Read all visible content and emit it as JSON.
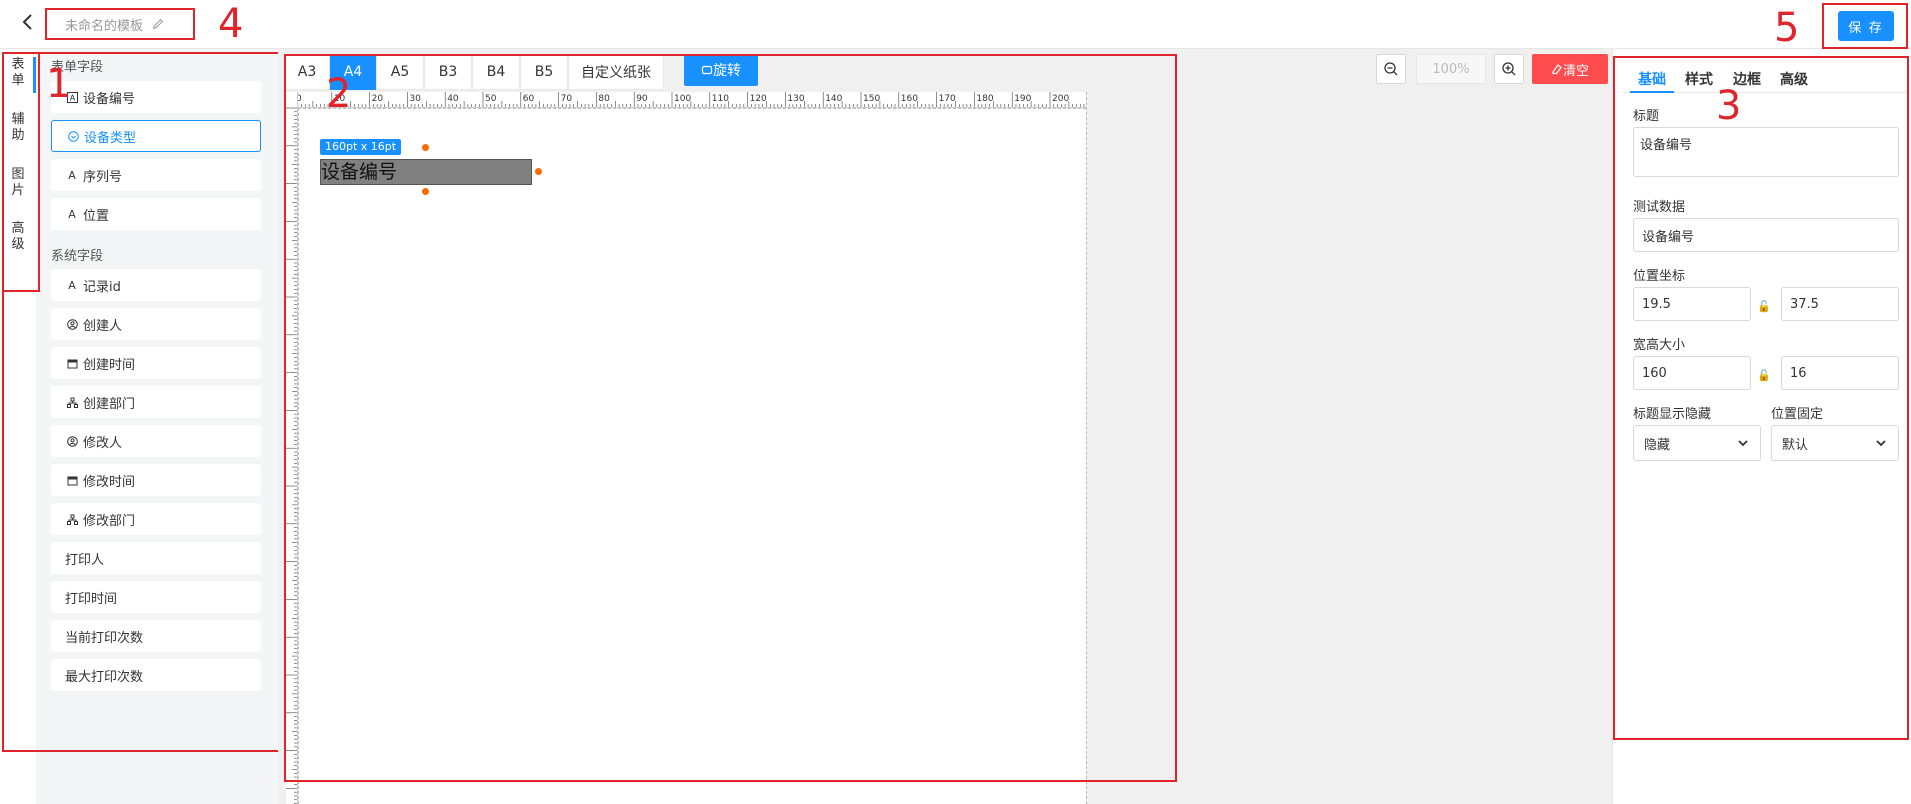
{
  "header": {
    "template_name": "未命名的模板",
    "save_label": "保 存"
  },
  "annotations": [
    "1",
    "2",
    "3",
    "4",
    "5"
  ],
  "left_tabs": [
    "表单",
    "辅助",
    "图片",
    "高级"
  ],
  "form_fields": {
    "group_title": "表单字段",
    "items": [
      {
        "label": "设备编号",
        "icon": "text-box-icon"
      },
      {
        "label": "设备类型",
        "icon": "radio-circle-icon",
        "selected": true
      },
      {
        "label": "序列号",
        "icon": "letter-a-icon"
      },
      {
        "label": "位置",
        "icon": "letter-a-icon"
      }
    ]
  },
  "system_fields": {
    "group_title": "系统字段",
    "items": [
      {
        "label": "记录id",
        "icon": "letter-a-icon"
      },
      {
        "label": "创建人",
        "icon": "user-circle-icon"
      },
      {
        "label": "创建时间",
        "icon": "calendar-icon"
      },
      {
        "label": "创建部门",
        "icon": "org-chart-icon"
      },
      {
        "label": "修改人",
        "icon": "user-circle-icon"
      },
      {
        "label": "修改时间",
        "icon": "calendar-icon"
      },
      {
        "label": "修改部门",
        "icon": "org-chart-icon"
      },
      {
        "label": "打印人",
        "icon": ""
      },
      {
        "label": "打印时间",
        "icon": ""
      },
      {
        "label": "当前打印次数",
        "icon": ""
      },
      {
        "label": "最大打印次数",
        "icon": ""
      }
    ]
  },
  "toolbar": {
    "paper_sizes": [
      "A3",
      "A4",
      "A5",
      "B3",
      "B4",
      "B5",
      "自定义纸张"
    ],
    "active_paper": "A4",
    "rotate_label": "旋转",
    "zoom": "100%",
    "clear_label": "清空"
  },
  "ruler": {
    "top_ticks": [
      "0",
      "10",
      "20",
      "30",
      "40",
      "50",
      "60",
      "70",
      "80",
      "90",
      "100",
      "110",
      "120",
      "130",
      "140",
      "150",
      "160",
      "170",
      "180",
      "190",
      "200"
    ]
  },
  "canvas_element": {
    "size_tag": "160pt x 16pt",
    "text": "设备编号"
  },
  "properties": {
    "tabs": [
      "基础",
      "样式",
      "边框",
      "高级"
    ],
    "active_tab": "基础",
    "title_label": "标题",
    "title_value": "设备编号",
    "test_data_label": "测试数据",
    "test_data_value": "设备编号",
    "position_label": "位置坐标",
    "pos_x": "19.5",
    "pos_y": "37.5",
    "size_label": "宽高大小",
    "width": "160",
    "height": "16",
    "title_visibility_label": "标题显示隐藏",
    "title_visibility_value": "隐藏",
    "position_fixed_label": "位置固定",
    "position_fixed_value": "默认"
  },
  "colors": {
    "primary": "#1890ff",
    "danger": "#ff4d4f",
    "annotation": "#e0242c",
    "handle": "#ff6a00"
  }
}
